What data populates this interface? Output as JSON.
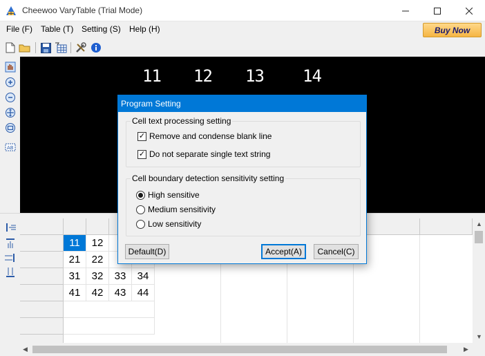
{
  "window": {
    "title": "Cheewoo VaryTable (Trial Mode)"
  },
  "menu": [
    {
      "label": "File (F)"
    },
    {
      "label": "Table (T)"
    },
    {
      "label": "Setting (S)"
    },
    {
      "label": "Help (H)"
    }
  ],
  "buy_now": "Buy Now",
  "canvas": {
    "handwritten_numbers": [
      "11",
      "12",
      "13",
      "14"
    ]
  },
  "grid": {
    "rows": [
      [
        "11",
        "12",
        "",
        ""
      ],
      [
        "21",
        "22",
        "",
        ""
      ],
      [
        "31",
        "32",
        "33",
        "34"
      ],
      [
        "41",
        "42",
        "43",
        "44"
      ]
    ]
  },
  "dialog": {
    "title": "Program Setting",
    "group1": {
      "label": "Cell text processing setting",
      "options": [
        {
          "label": "Remove and condense blank line",
          "checked": true
        },
        {
          "label": "Do not separate single text string",
          "checked": true
        }
      ]
    },
    "group2": {
      "label": "Cell boundary detection sensitivity setting",
      "options": [
        {
          "label": "High sensitive",
          "selected": true
        },
        {
          "label": "Medium sensitivity",
          "selected": false
        },
        {
          "label": "Low sensitivity",
          "selected": false
        }
      ]
    },
    "buttons": {
      "default": "Default(D)",
      "accept": "Accept(A)",
      "cancel": "Cancel(C)"
    }
  },
  "colors": {
    "accent": "#0078d7",
    "canvas": "#000000",
    "buy_now": "#f5b544"
  },
  "icons": {
    "titlebar": [
      "app-icon"
    ],
    "toolbar": [
      "new-file-icon",
      "open-folder-icon",
      "save-icon",
      "table-export-icon",
      "tools-icon",
      "info-icon"
    ],
    "left_tools": [
      "hand-icon",
      "zoom-in-icon",
      "zoom-out-icon",
      "zoom-fit-icon",
      "zoom-reset-icon",
      "text-select-icon"
    ],
    "grid_tools": [
      "insert-column-icon",
      "insert-row-icon",
      "split-column-icon",
      "split-row-icon"
    ]
  }
}
